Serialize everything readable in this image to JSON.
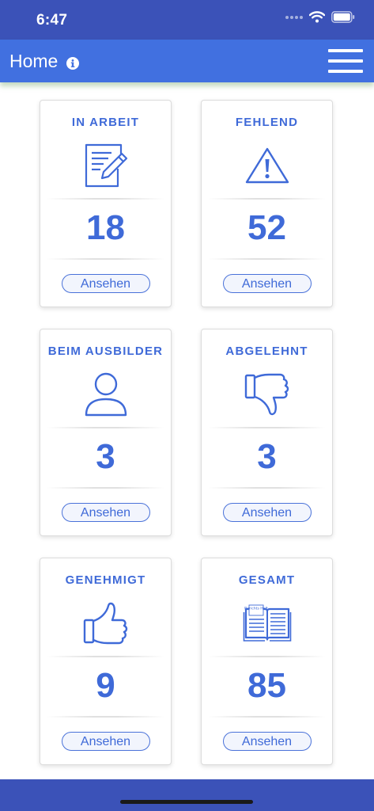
{
  "status_bar": {
    "time": "6:47"
  },
  "app_bar": {
    "title": "Home"
  },
  "cards": [
    {
      "title": "IN ARBEIT",
      "count": "18",
      "button": "Ansehen",
      "icon": "document-edit-icon"
    },
    {
      "title": "FEHLEND",
      "count": "52",
      "button": "Ansehen",
      "icon": "warning-icon"
    },
    {
      "title": "BEIM AUSBILDER",
      "count": "3",
      "button": "Ansehen",
      "icon": "person-icon"
    },
    {
      "title": "ABGELEHNT",
      "count": "3",
      "button": "Ansehen",
      "icon": "thumbs-down-icon"
    },
    {
      "title": "GENEHMIGT",
      "count": "9",
      "button": "Ansehen",
      "icon": "thumbs-up-icon"
    },
    {
      "title": "GESAMT",
      "count": "85",
      "button": "Ansehen",
      "icon": "book-icon",
      "icon_label": "Berichts Heft"
    }
  ],
  "colors": {
    "status_bar": "#3b52b8",
    "app_bar": "#4170e0",
    "accent": "#3f6ad8"
  }
}
